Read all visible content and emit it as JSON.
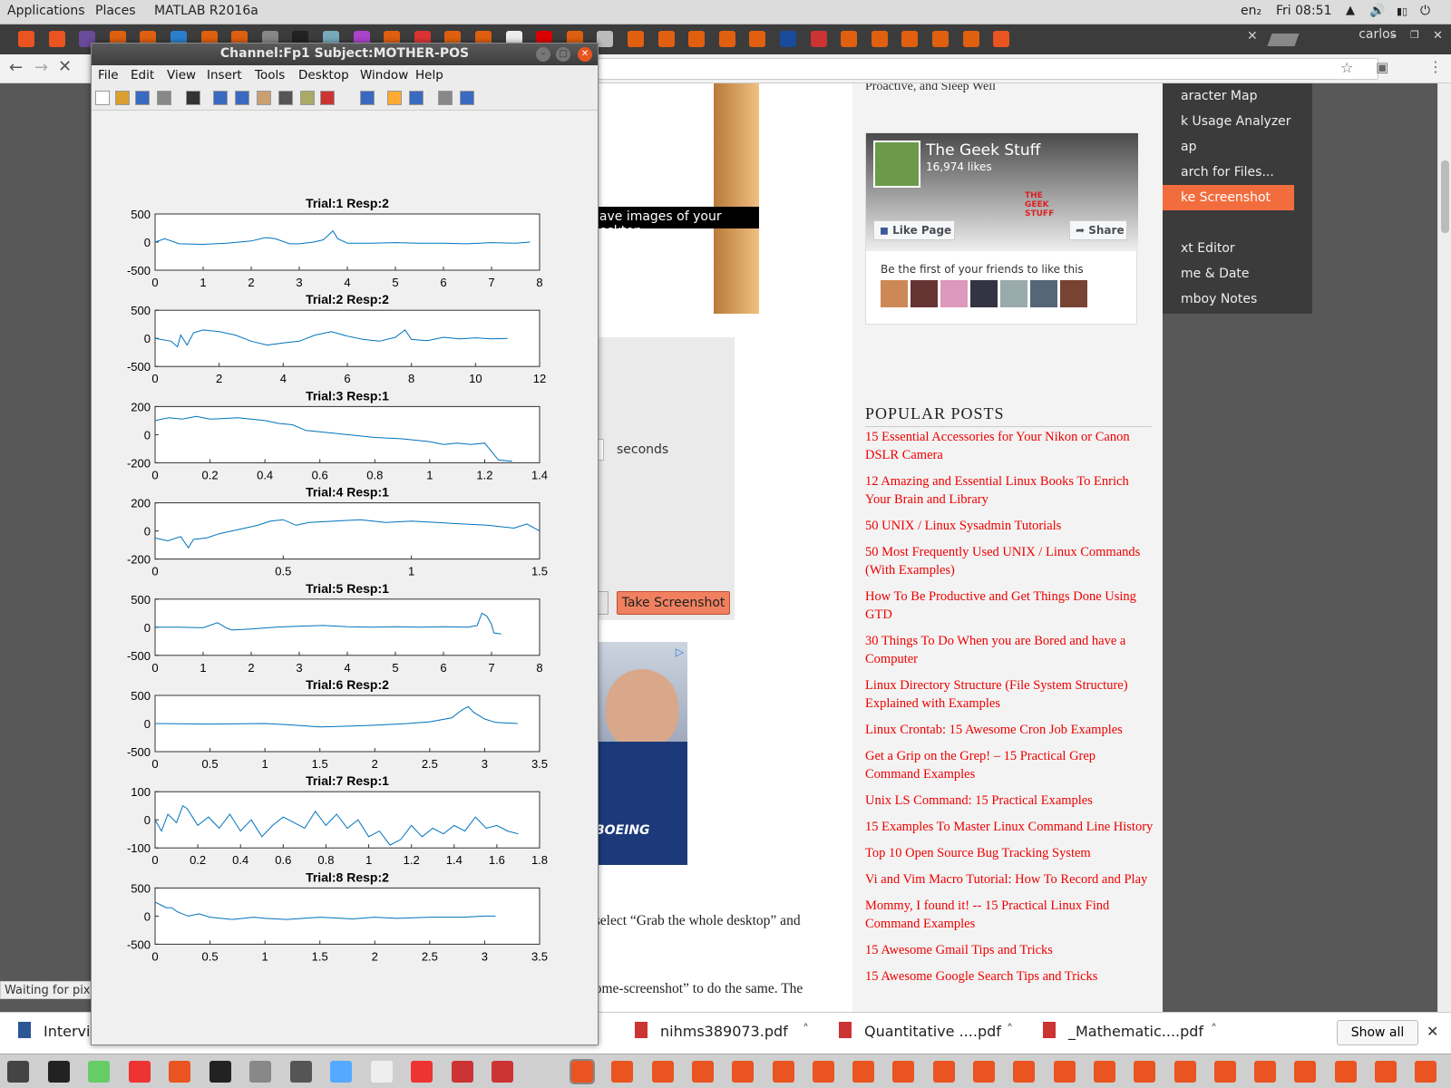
{
  "topbar": {
    "applications": "Applications",
    "places": "Places",
    "app": "MATLAB R2016a",
    "lang": "en₂",
    "clock": "Fri 08:51"
  },
  "tabs": {
    "user": "carlos"
  },
  "browser_menu": {
    "items": [
      "aracter Map",
      "k Usage Analyzer",
      "ap",
      "arch for Files...",
      "ke Screenshot",
      "xt Editor",
      "me & Date",
      "mboy Notes"
    ],
    "tooltip": "Save images of your desktop"
  },
  "dialog": {
    "opt1": "p",
    "opt2": "w",
    "seconds": "seconds",
    "take_button": "Take Screenshot"
  },
  "article": {
    "line1": ", select “Grab the whole desktop” and",
    "line2": "home-screenshot” to do the same. The",
    "top_text": "Proactive, and Sleep Well"
  },
  "ad": {
    "brand": "BOEING"
  },
  "facebook": {
    "name": "The Geek Stuff",
    "likes": "16,974 likes",
    "like_btn": "Like Page",
    "share_btn": "Share",
    "friends": "Be the first of your friends to like this",
    "logo": "THE GEEK STUFF"
  },
  "popular": {
    "heading": "POPULAR POSTS",
    "links": [
      "15 Essential Accessories for Your Nikon or Canon DSLR Camera",
      "12 Amazing and Essential Linux Books To Enrich Your Brain and Library",
      "50 UNIX / Linux Sysadmin Tutorials",
      "50 Most Frequently Used UNIX / Linux Commands (With Examples)",
      "How To Be Productive and Get Things Done Using GTD",
      "30 Things To Do When you are Bored and have a Computer",
      "Linux Directory Structure (File System Structure) Explained with Examples",
      "Linux Crontab: 15 Awesome Cron Job Examples",
      "Get a Grip on the Grep! – 15 Practical Grep Command Examples",
      "Unix LS Command: 15 Practical Examples",
      "15 Examples To Master Linux Command Line History",
      "Top 10 Open Source Bug Tracking System",
      "Vi and Vim Macro Tutorial: How To Record and Play",
      "Mommy, I found it! -- 15 Practical Linux Find Command Examples",
      "15 Awesome Gmail Tips and Tricks",
      "15 Awesome Google Search Tips and Tricks"
    ]
  },
  "status": {
    "text": "Waiting for pix"
  },
  "downloads": {
    "items": [
      "Intervie",
      "nihms389073.pdf",
      "Quantitative ....pdf",
      "_Mathematic....pdf"
    ],
    "show_all": "Show all"
  },
  "matlab": {
    "title": "Channel:Fp1 Subject:MOTHER-POS",
    "menu": [
      "File",
      "Edit",
      "View",
      "Insert",
      "Tools",
      "Desktop",
      "Window",
      "Help"
    ]
  },
  "chart_data": [
    {
      "type": "line",
      "title": "Trial:1 Resp:2",
      "ylim": [
        -500,
        500
      ],
      "yticks": [
        "500",
        "0",
        "-500"
      ],
      "xlim": [
        0,
        8
      ],
      "xticks": [
        "0",
        "1",
        "2",
        "3",
        "4",
        "5",
        "6",
        "7",
        "8"
      ],
      "x": [
        0,
        0.2,
        0.5,
        1,
        1.5,
        2,
        2.3,
        2.5,
        2.8,
        3,
        3.3,
        3.5,
        3.6,
        3.7,
        3.8,
        4,
        4.5,
        5,
        5.5,
        6,
        6.5,
        7,
        7.5,
        7.8
      ],
      "y": [
        0,
        60,
        -30,
        -40,
        -20,
        20,
        80,
        60,
        -30,
        -30,
        0,
        40,
        120,
        200,
        60,
        -20,
        -20,
        -10,
        -20,
        -20,
        -30,
        -10,
        -20,
        0
      ]
    },
    {
      "type": "line",
      "title": "Trial:2 Resp:2",
      "ylim": [
        -500,
        500
      ],
      "yticks": [
        "500",
        "0",
        "-500"
      ],
      "xlim": [
        0,
        12
      ],
      "xticks": [
        "0",
        "2",
        "4",
        "6",
        "8",
        "10",
        "12"
      ],
      "x": [
        0,
        0.5,
        0.7,
        0.8,
        1,
        1.2,
        1.5,
        2,
        2.5,
        3,
        3.5,
        4,
        4.5,
        5,
        5.5,
        6,
        6.5,
        7,
        7.5,
        7.8,
        8,
        8.5,
        9,
        9.5,
        10,
        10.5,
        11
      ],
      "y": [
        0,
        -50,
        -150,
        60,
        -120,
        100,
        150,
        120,
        60,
        -50,
        -120,
        -80,
        -50,
        60,
        120,
        40,
        -20,
        -50,
        20,
        150,
        -20,
        -40,
        20,
        -10,
        10,
        -10,
        0
      ]
    },
    {
      "type": "line",
      "title": "Trial:3 Resp:1",
      "ylim": [
        -200,
        200
      ],
      "yticks": [
        "200",
        "0",
        "-200"
      ],
      "xlim": [
        0,
        1.4
      ],
      "xticks": [
        "0",
        "0.2",
        "0.4",
        "0.6",
        "0.8",
        "1",
        "1.2",
        "1.4"
      ],
      "x": [
        0,
        0.05,
        0.1,
        0.15,
        0.2,
        0.25,
        0.3,
        0.35,
        0.4,
        0.45,
        0.5,
        0.55,
        0.6,
        0.7,
        0.8,
        0.9,
        1,
        1.05,
        1.1,
        1.15,
        1.2,
        1.25,
        1.3
      ],
      "y": [
        100,
        120,
        110,
        130,
        110,
        115,
        120,
        110,
        100,
        80,
        70,
        30,
        20,
        0,
        -20,
        -30,
        -50,
        -70,
        -60,
        -70,
        -60,
        -180,
        -190
      ]
    },
    {
      "type": "line",
      "title": "Trial:4 Resp:1",
      "ylim": [
        -200,
        200
      ],
      "yticks": [
        "200",
        "0",
        "-200"
      ],
      "xlim": [
        0,
        1.5
      ],
      "xticks": [
        "0",
        "0.5",
        "1",
        "1.5"
      ],
      "x": [
        0,
        0.05,
        0.1,
        0.13,
        0.15,
        0.2,
        0.25,
        0.3,
        0.35,
        0.4,
        0.45,
        0.5,
        0.55,
        0.6,
        0.7,
        0.8,
        0.9,
        1,
        1.1,
        1.2,
        1.3,
        1.4,
        1.45,
        1.5
      ],
      "y": [
        -50,
        -70,
        -40,
        -120,
        -60,
        -50,
        -20,
        0,
        20,
        40,
        70,
        80,
        40,
        60,
        70,
        80,
        60,
        70,
        60,
        50,
        40,
        20,
        50,
        0
      ]
    },
    {
      "type": "line",
      "title": "Trial:5 Resp:1",
      "ylim": [
        -500,
        500
      ],
      "yticks": [
        "500",
        "0",
        "-500"
      ],
      "xlim": [
        0,
        8
      ],
      "xticks": [
        "0",
        "1",
        "2",
        "3",
        "4",
        "5",
        "6",
        "7",
        "8"
      ],
      "x": [
        0,
        0.5,
        1,
        1.3,
        1.5,
        1.6,
        2,
        2.5,
        3,
        3.5,
        4,
        4.5,
        5,
        5.5,
        6,
        6.5,
        6.7,
        6.8,
        6.9,
        7,
        7.05,
        7.2
      ],
      "y": [
        0,
        0,
        -10,
        80,
        -20,
        -50,
        -30,
        0,
        20,
        30,
        10,
        0,
        10,
        0,
        10,
        0,
        30,
        250,
        200,
        50,
        -100,
        -120
      ]
    },
    {
      "type": "line",
      "title": "Trial:6 Resp:2",
      "ylim": [
        -500,
        500
      ],
      "yticks": [
        "500",
        "0",
        "-500"
      ],
      "xlim": [
        0,
        3.5
      ],
      "xticks": [
        "0",
        "0.5",
        "1",
        "1.5",
        "2",
        "2.5",
        "3",
        "3.5"
      ],
      "x": [
        0,
        0.5,
        1,
        1.2,
        1.5,
        1.7,
        2,
        2.3,
        2.5,
        2.7,
        2.8,
        2.85,
        2.9,
        3,
        3.1,
        3.3
      ],
      "y": [
        0,
        -10,
        0,
        -20,
        -60,
        -50,
        -30,
        0,
        30,
        100,
        250,
        300,
        200,
        80,
        20,
        0
      ]
    },
    {
      "type": "line",
      "title": "Trial:7 Resp:1",
      "ylim": [
        -100,
        100
      ],
      "yticks": [
        "100",
        "0",
        "-100"
      ],
      "xlim": [
        0,
        1.8
      ],
      "xticks": [
        "0",
        "0.2",
        "0.4",
        "0.6",
        "0.8",
        "1",
        "1.2",
        "1.4",
        "1.6",
        "1.8"
      ],
      "x": [
        0,
        0.03,
        0.06,
        0.1,
        0.13,
        0.15,
        0.2,
        0.25,
        0.3,
        0.35,
        0.4,
        0.45,
        0.5,
        0.55,
        0.6,
        0.7,
        0.75,
        0.8,
        0.85,
        0.9,
        0.95,
        1,
        1.05,
        1.1,
        1.15,
        1.2,
        1.25,
        1.3,
        1.35,
        1.4,
        1.45,
        1.5,
        1.55,
        1.6,
        1.65,
        1.7
      ],
      "y": [
        0,
        -40,
        20,
        -10,
        50,
        40,
        -20,
        10,
        -30,
        20,
        -40,
        0,
        -60,
        -20,
        10,
        -30,
        30,
        -20,
        20,
        -30,
        0,
        -60,
        -40,
        -90,
        -70,
        -20,
        -60,
        -30,
        -50,
        -20,
        -40,
        10,
        -30,
        -20,
        -40,
        -50
      ]
    },
    {
      "type": "line",
      "title": "Trial:8 Resp:2",
      "ylim": [
        -500,
        500
      ],
      "yticks": [
        "500",
        "0",
        "-500"
      ],
      "xlim": [
        0,
        3.5
      ],
      "xticks": [
        "0",
        "0.5",
        "1",
        "1.5",
        "2",
        "2.5",
        "3",
        "3.5"
      ],
      "x": [
        0,
        0.05,
        0.1,
        0.15,
        0.2,
        0.3,
        0.4,
        0.5,
        0.7,
        0.9,
        1,
        1.2,
        1.5,
        1.8,
        2,
        2.2,
        2.5,
        2.8,
        3,
        3.1
      ],
      "y": [
        250,
        200,
        150,
        150,
        80,
        0,
        40,
        -20,
        -60,
        -20,
        -40,
        -60,
        -20,
        -50,
        -20,
        -40,
        -20,
        -20,
        0,
        0
      ]
    }
  ],
  "colors": {
    "plot_line": "#0072bd",
    "accent_orange": "#e95420",
    "link_red": "#e00000"
  }
}
